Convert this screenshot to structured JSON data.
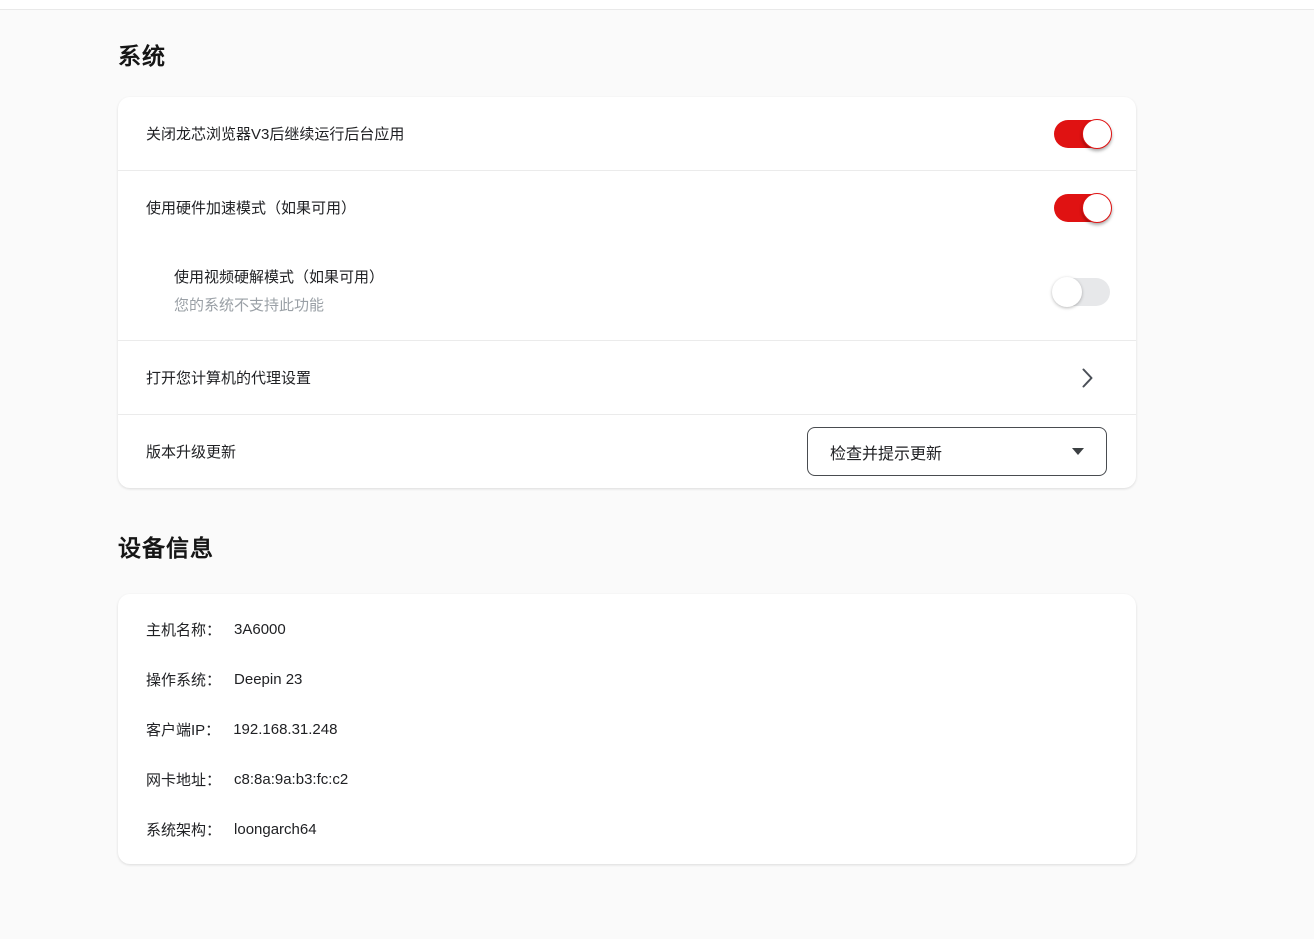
{
  "colors": {
    "accent_red": "#e01212",
    "page_background": "#fafafa",
    "card_background": "#ffffff",
    "toggle_off_track": "#e7e8ea",
    "secondary_text": "#9aa0a6"
  },
  "icons": {
    "proxy_row": "chevron-right",
    "update_dropdown": "caret-down"
  },
  "system_section": {
    "title": "系统",
    "rows": {
      "background_apps": {
        "label": "关闭龙芯浏览器V3后继续运行后台应用",
        "toggle_state": "on"
      },
      "hardware_accel": {
        "label": "使用硬件加速模式（如果可用）",
        "toggle_state": "on"
      },
      "video_decode": {
        "label": "使用视频硬解模式（如果可用）",
        "sublabel": "您的系统不支持此功能",
        "toggle_state": "off"
      },
      "proxy": {
        "label": "打开您计算机的代理设置"
      },
      "update": {
        "label": "版本升级更新",
        "selected_option": "检查并提示更新"
      }
    }
  },
  "device_section": {
    "title": "设备信息",
    "items": [
      {
        "label": "主机名称：",
        "value": "3A6000"
      },
      {
        "label": "操作系统：",
        "value": "Deepin 23"
      },
      {
        "label": "客户端IP：",
        "value": "192.168.31.248"
      },
      {
        "label": "网卡地址：",
        "value": "c8:8a:9a:b3:fc:c2"
      },
      {
        "label": "系统架构：",
        "value": "loongarch64"
      }
    ]
  }
}
